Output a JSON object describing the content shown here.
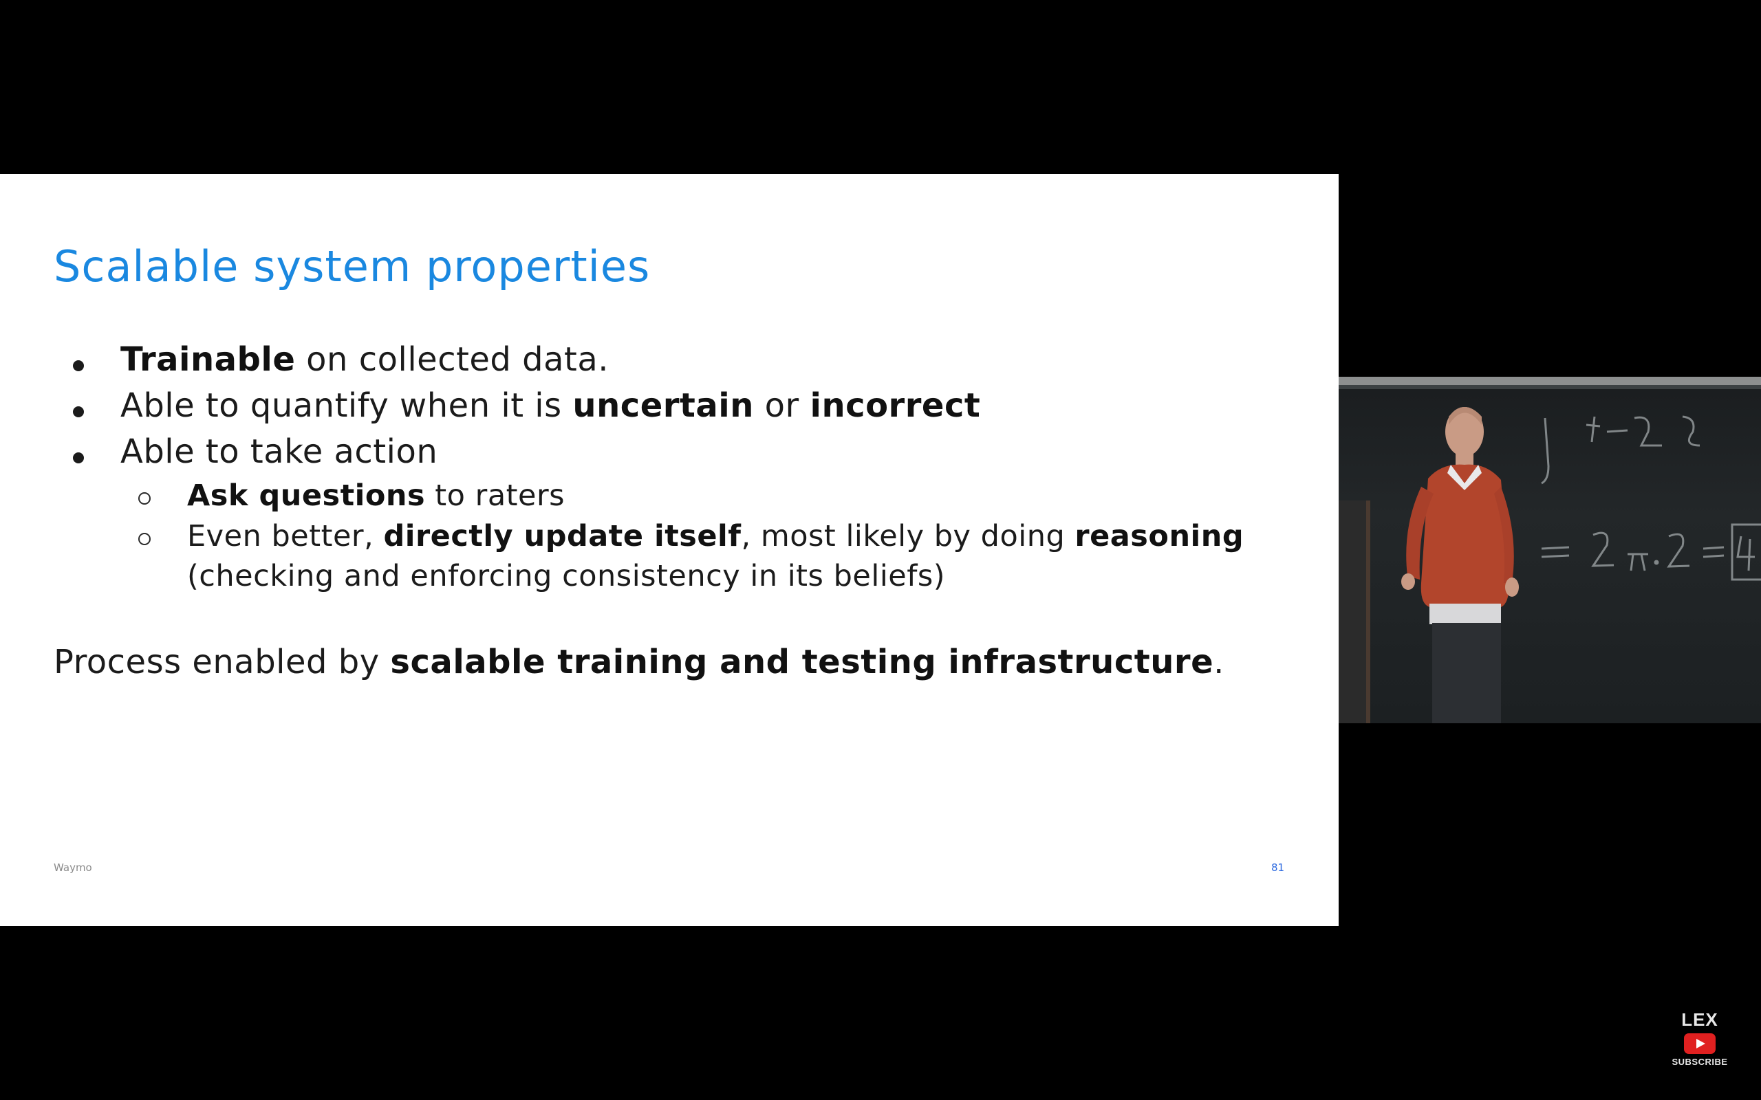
{
  "slide": {
    "title": "Scalable system properties",
    "bullets": [
      {
        "bold": "Trainable",
        "rest": " on collected data."
      },
      {
        "pre": "Able to quantify when it is ",
        "bold1": "uncertain",
        "mid": " or ",
        "bold2": "incorrect"
      },
      {
        "text": "Able to take action"
      }
    ],
    "subbullets": [
      {
        "bold": "Ask questions",
        "rest": " to raters"
      },
      {
        "pre": "Even better, ",
        "bold1": "directly update itself",
        "mid": ", most likely by doing ",
        "bold2": "reasoning",
        "cont": "(checking and enforcing consistency in its beliefs)"
      }
    ],
    "process": {
      "pre": "Process enabled by ",
      "bold": "scalable training and testing infrastructure",
      "post": "."
    },
    "footer_left": "Waymo",
    "page_number": "81"
  },
  "video": {
    "description_icon": "lecturer-video-icon"
  },
  "logo": {
    "text": "LEX",
    "subscribe": "SUBSCRIBE",
    "icon": "youtube-play-icon"
  }
}
